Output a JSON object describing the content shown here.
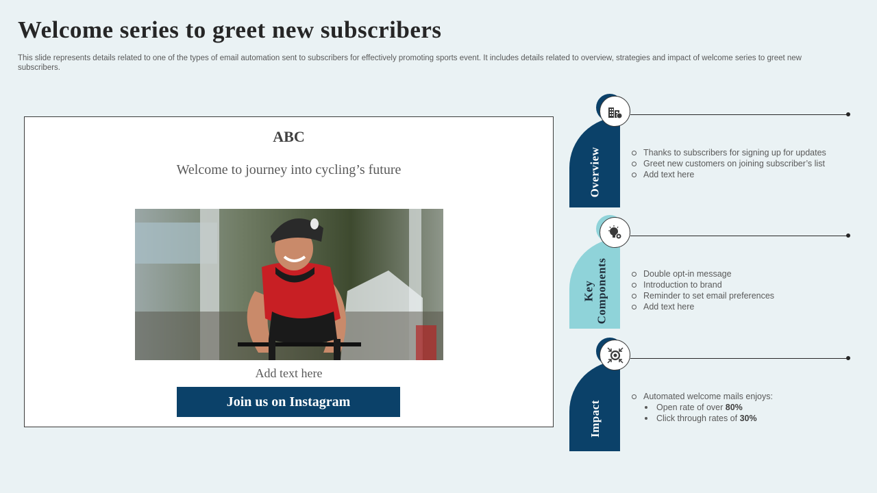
{
  "slide": {
    "title": "Welcome series to greet new subscribers",
    "subtitle": "This slide represents details related to one of the types of email automation sent to subscribers for effectively promoting sports event. It includes details related to overview, strategies and impact of welcome series to greet new subscribers."
  },
  "email": {
    "brand": "ABC",
    "headline": "Welcome to journey into cycling’s future",
    "caption": "Add text here",
    "cta_label": "Join us on Instagram"
  },
  "sections": {
    "overview": {
      "label": "Overview",
      "icon": "buildings-icon",
      "items": [
        "Thanks to subscribers for signing up for updates",
        "Greet new customers on joining subscriber’s list",
        "Add text here"
      ]
    },
    "key_components": {
      "label_line1": "Key",
      "label_line2": "Components",
      "icon": "lightbulb-gear-icon",
      "items": [
        "Double opt-in message",
        "Introduction to brand",
        "Reminder to set email preferences",
        "Add text here"
      ]
    },
    "impact": {
      "label": "Impact",
      "icon": "gear-arrows-icon",
      "intro": "Automated welcome mails enjoys:",
      "sub_items": [
        {
          "text": "Open rate of over ",
          "value": "80%"
        },
        {
          "text": "Click through rates of ",
          "value": "30%"
        }
      ]
    }
  },
  "colors": {
    "background": "#eaf2f4",
    "dark_blue": "#0b4169",
    "light_teal": "#8fd3d9"
  }
}
